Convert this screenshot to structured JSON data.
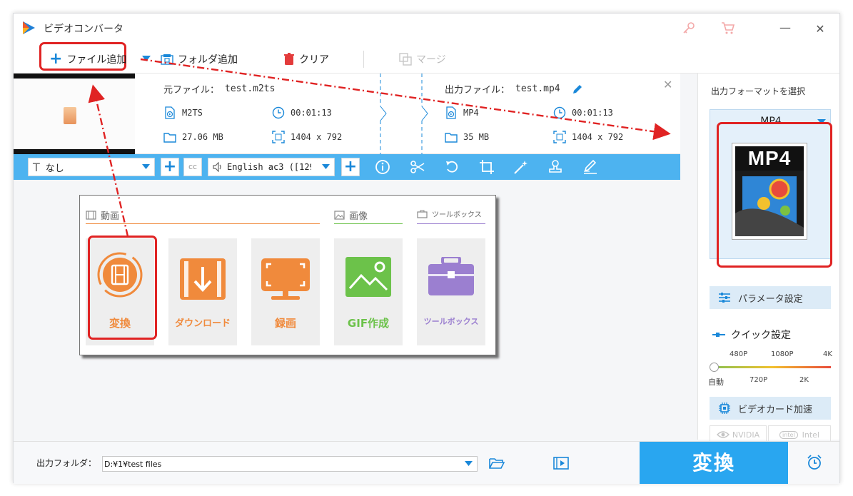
{
  "window": {
    "title": "ビデオコンバータ",
    "controls": {
      "key_icon": "key-icon",
      "cart_icon": "cart-icon",
      "minimize": "—",
      "close": "✕"
    }
  },
  "toolbar": {
    "add_file": "ファイル追加",
    "add_folder": "フォルダ追加",
    "clear": "クリア",
    "merge": "マージ"
  },
  "file": {
    "source_label": "元ファイル：",
    "source_name": "test.m2ts",
    "source_format": "M2TS",
    "source_duration": "00:01:13",
    "source_size": "27.06 MB",
    "source_resolution": "1404 x 792",
    "output_label": "出力ファイル：",
    "output_name": "test.mp4",
    "output_format": "MP4",
    "output_duration": "00:01:13",
    "output_size": "35 MB",
    "output_resolution": "1404 x 792"
  },
  "editbar": {
    "subtitle_value": "なし",
    "audio_value": "English ac3 ([129]"
  },
  "features": {
    "sections": {
      "video": "動画",
      "image": "画像",
      "toolbox": "ツールボックス"
    },
    "cards": [
      {
        "label": "変換",
        "color": "#f08a3c"
      },
      {
        "label": "ダウンロード",
        "color": "#f08a3c"
      },
      {
        "label": "録画",
        "color": "#f08a3c"
      },
      {
        "label": "GIF作成",
        "color": "#6cc24a"
      },
      {
        "label": "ツールボックス",
        "color": "#9b7fd0"
      }
    ]
  },
  "right_panel": {
    "select_format_label": "出力フォーマットを選択",
    "format_name": "MP4",
    "format_icon_text": "MP4",
    "param_button": "パラメータ設定",
    "quick_settings": "クイック設定",
    "slider_top_labels": [
      "480P",
      "1080P",
      "4K"
    ],
    "slider_bottom_labels": [
      "自動",
      "720P",
      "2K"
    ],
    "gpu_accel": "ビデオカード加速",
    "nvidia": "NVIDIA",
    "intel": "Intel"
  },
  "bottom": {
    "output_folder_label": "出力フォルダ：",
    "output_folder_path": "D:¥1¥test files",
    "convert": "変換"
  },
  "colors": {
    "accent_blue": "#29a6f0",
    "editbar_blue": "#4db3f0",
    "annotation_red": "#e02323",
    "orange": "#f08a3c",
    "green": "#6cc24a",
    "purple": "#9b7fd0"
  }
}
